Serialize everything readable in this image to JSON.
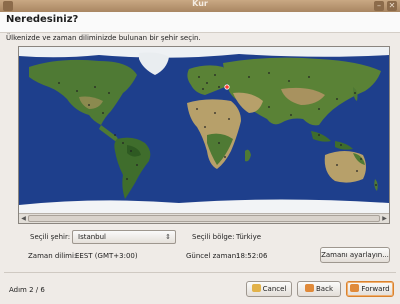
{
  "window": {
    "title": "Kur",
    "close_glyph": "✕",
    "min_glyph": "–"
  },
  "page": {
    "heading": "Neredesiniz?",
    "instruction": "Ülkenizde ve zaman diliminizde bulunan bir şehir seçin."
  },
  "city": {
    "label": "Seçili şehir:",
    "value": "Istanbul"
  },
  "region": {
    "label": "Seçili bölge:",
    "value": "Türkiye"
  },
  "timezone": {
    "label": "Zaman dilimi:",
    "value": "EEST (GMT+3:00)"
  },
  "time": {
    "label": "Güncel zaman:",
    "value": "18:52:06"
  },
  "set_time_button": "Zamanı ayarlayın...",
  "step": "Adım 2 / 6",
  "buttons": {
    "cancel": "Cancel",
    "back": "Back",
    "forward": "Forward"
  },
  "icons": {
    "map": "world-map-icon",
    "cancel": "cancel-icon",
    "back": "back-arrow-icon",
    "forward": "forward-arrow-icon"
  },
  "colors": {
    "ocean": "#1e3f8c",
    "land": "#4f7a34",
    "desert": "#b7a06a",
    "ice": "#f2f4f6",
    "accent": "#d9822e"
  }
}
